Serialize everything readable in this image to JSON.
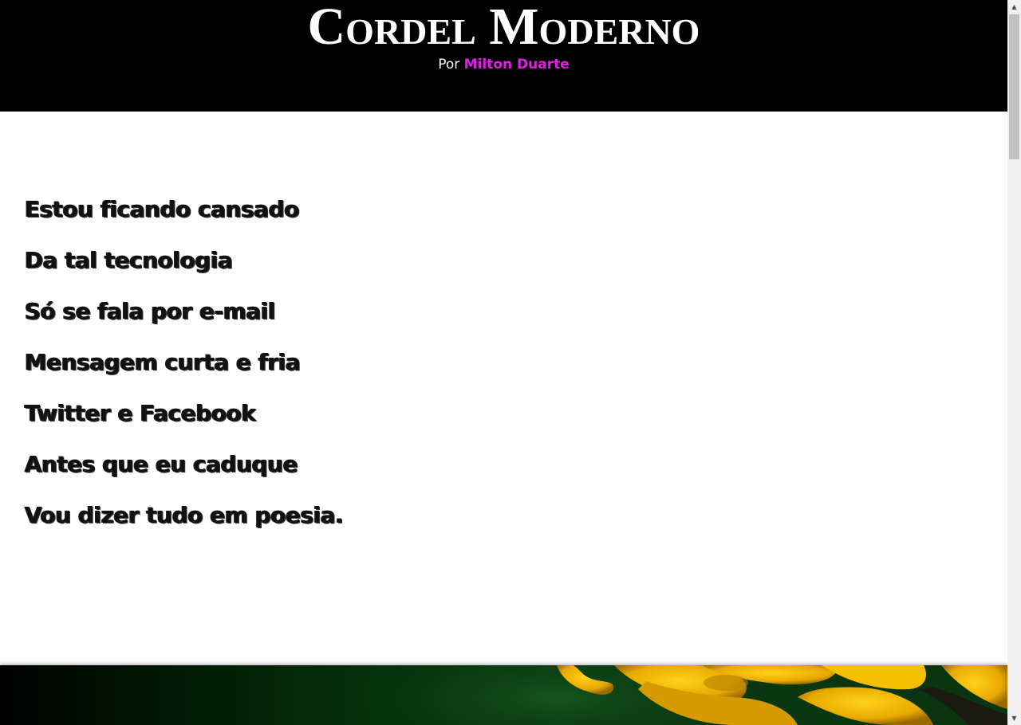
{
  "header": {
    "title": "Cordel Moderno",
    "byline_prefix": "Por",
    "author": "Milton Duarte",
    "author_color": "#e020e0",
    "background": "#000000"
  },
  "poem": {
    "verses": [
      "Estou ficando cansado",
      "Da tal tecnologia",
      "Só se fala por e-mail",
      "Mensagem curta e fria",
      "Twitter e Facebook",
      "Antes que eu caduque",
      "Vou dizer tudo em poesia."
    ]
  },
  "footer": {
    "image_subject": "yellow-flowers-photo"
  },
  "scrollbar": {
    "up_icon": "scroll-up-arrow-icon",
    "down_icon": "scroll-down-arrow-icon"
  }
}
